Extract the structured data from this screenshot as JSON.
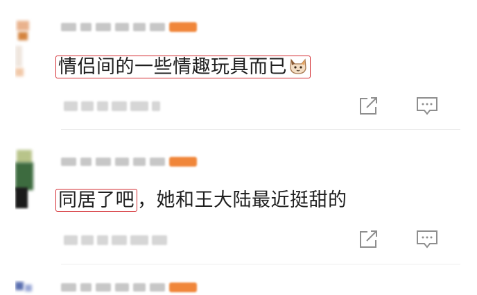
{
  "comments": [
    {
      "highlight": "情侣间的一些情趣玩具而已",
      "rest": "",
      "emoji": "cat-face-emoji"
    },
    {
      "highlight": "同居了吧",
      "rest": "，她和王大陆最近挺甜的",
      "emoji": ""
    }
  ],
  "icons": {
    "share": "share-icon",
    "reply": "comment-icon"
  },
  "colors": {
    "highlight_border": "#d3292e",
    "badge": "#f0863a",
    "text": "#1f1f1f"
  }
}
